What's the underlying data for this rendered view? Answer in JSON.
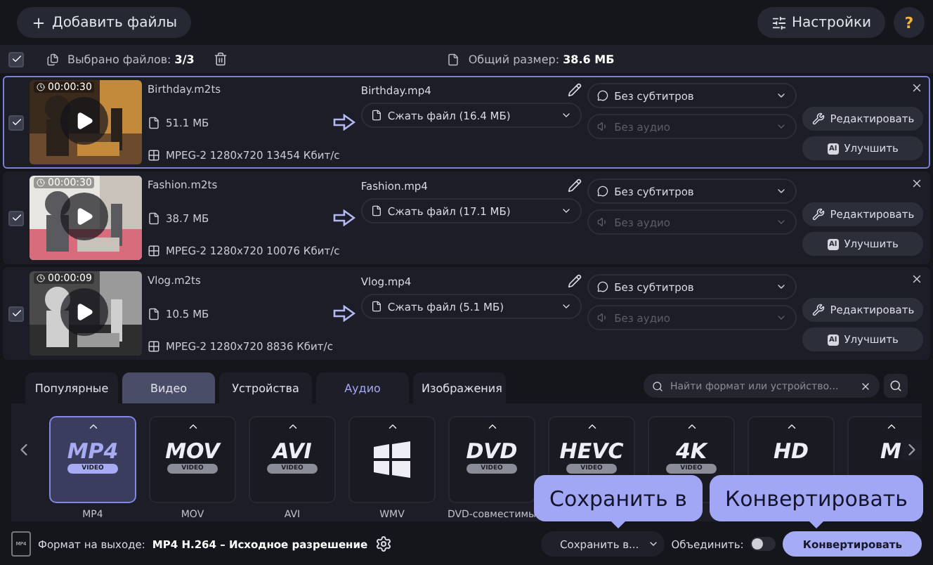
{
  "toolbar": {
    "add_files": "Добавить файлы",
    "settings": "Настройки",
    "help": "?"
  },
  "selection": {
    "checked": true,
    "count": "Выбрано файлов: **3/3**",
    "total": "Общий размер: **38.6 МБ**"
  },
  "files": [
    {
      "selected": true,
      "checked": true,
      "duration": "00:00:30",
      "name": "Birthday.m2ts",
      "size": "51.1 МБ",
      "codec": "MPEG-2 1280x720 13454 Кбит/с",
      "output_name": "Birthday.mp4",
      "compress": "Сжать файл (16.4 МБ)",
      "subtitles": "Без субтитров",
      "audio": "Без аудио",
      "edit": "Редактировать",
      "ai": "AI",
      "enhance": "Улучшить"
    },
    {
      "selected": false,
      "checked": true,
      "duration": "00:00:30",
      "name": "Fashion.m2ts",
      "size": "38.7 МБ",
      "codec": "MPEG-2 1280x720 10076 Кбит/с",
      "output_name": "Fashion.mp4",
      "compress": "Сжать файл (17.1 МБ)",
      "subtitles": "Без субтитров",
      "audio": "Без аудио",
      "edit": "Редактировать",
      "ai": "AI",
      "enhance": "Улучшить"
    },
    {
      "selected": false,
      "checked": true,
      "duration": "00:00:09",
      "name": "Vlog.m2ts",
      "size": "10.5 МБ",
      "codec": "MPEG-2 1280x720 8836 Кбит/с",
      "output_name": "Vlog.mp4",
      "compress": "Сжать файл (5.1 МБ)",
      "subtitles": "Без субтитров",
      "audio": "Без аудио",
      "edit": "Редактировать",
      "ai": "AI",
      "enhance": "Улучшить"
    }
  ],
  "tabs": [
    {
      "label": "Популярные",
      "selected": false,
      "accent": false
    },
    {
      "label": "Видео",
      "selected": true,
      "accent": false
    },
    {
      "label": "Устройства",
      "selected": false,
      "accent": false
    },
    {
      "label": "Аудио",
      "selected": false,
      "accent": true
    },
    {
      "label": "Изображения",
      "selected": false,
      "accent": false
    }
  ],
  "search": {
    "placeholder": "Найти формат или устройство..."
  },
  "formats": [
    {
      "kind": "text",
      "logo": "MP4",
      "sub": "VIDEO",
      "label": "MP4",
      "selected": true
    },
    {
      "kind": "text",
      "logo": "MOV",
      "sub": "VIDEO",
      "label": "MOV",
      "selected": false
    },
    {
      "kind": "text",
      "logo": "AVI",
      "sub": "VIDEO",
      "label": "AVI",
      "selected": false
    },
    {
      "kind": "windows",
      "label": "WMV",
      "selected": false
    },
    {
      "kind": "text",
      "logo": "DVD",
      "sub": "VIDEO",
      "label": "DVD-совместимы",
      "selected": false
    },
    {
      "kind": "text",
      "logo": "HEVC",
      "sub": "VIDEO",
      "selected": false
    },
    {
      "kind": "text",
      "logo": "4K",
      "sub": "VIDEO",
      "selected": false
    },
    {
      "kind": "text",
      "logo": "HD",
      "selected": false
    },
    {
      "kind": "text",
      "logo": "M",
      "selected": false
    }
  ],
  "output": {
    "icon_text": "MP4",
    "label": "Формат на выходе:",
    "value": "MP4 H.264 – Исходное разрешение",
    "save": "Сохранить в...",
    "merge": "Объединить:",
    "merge_on": false,
    "convert": "Конвертировать"
  },
  "callouts": [
    "Сохранить в",
    "Конвертировать"
  ]
}
